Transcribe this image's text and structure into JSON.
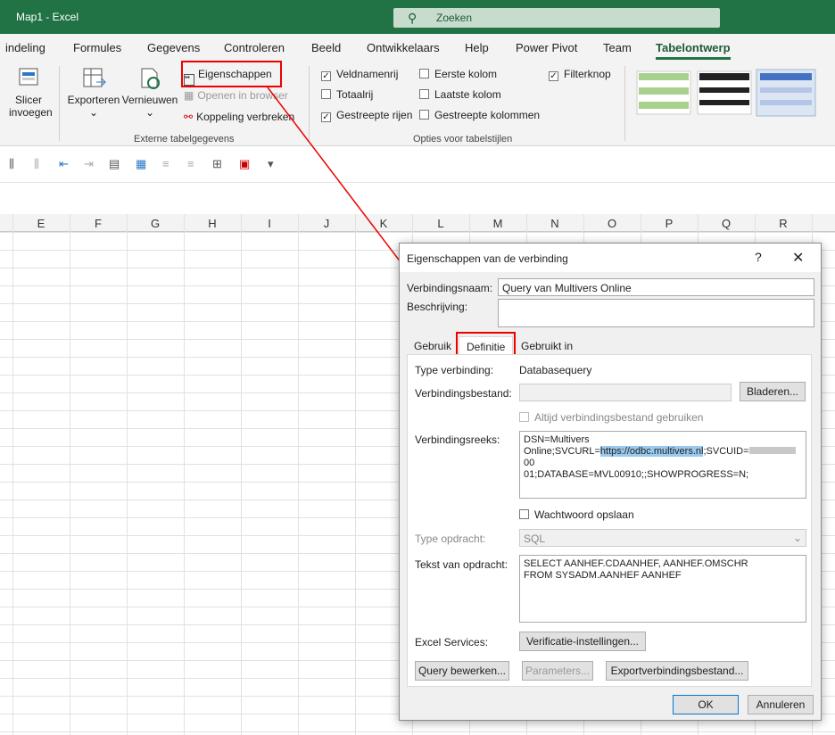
{
  "titlebar": {
    "title": "Map1  -  Excel",
    "search": "Zoeken",
    "search_icon": "search-icon"
  },
  "tabs": [
    "indeling",
    "Formules",
    "Gegevens",
    "Controleren",
    "Beeld",
    "Ontwikkelaars",
    "Help",
    "Power Pivot",
    "Team",
    "Tabelontwerp"
  ],
  "ribbon": {
    "slicer_1": "Slicer",
    "slicer_2": "invoegen",
    "exporteren": "Exporteren",
    "vernieuwen": "Vernieuwen",
    "eigenschappen": "Eigenschappen",
    "openen_browser": "Openen in browser",
    "koppeling": "Koppeling verbreken",
    "group_ext": "Externe tabelgegevens",
    "opt_veldnamenrij": "Veldnamenrij",
    "opt_totaalrij": "Totaalrij",
    "opt_gestreepte_rijen": "Gestreepte rijen",
    "opt_eerste_kolom": "Eerste kolom",
    "opt_laatste_kolom": "Laatste kolom",
    "opt_gestreepte_kolommen": "Gestreepte kolommen",
    "opt_filterknop": "Filterknop",
    "group_opties": "Opties voor tabelstijlen"
  },
  "columns": [
    "E",
    "F",
    "G",
    "H",
    "I",
    "J",
    "K",
    "L",
    "M",
    "N",
    "O",
    "P",
    "Q",
    "R"
  ],
  "dialog": {
    "title": "Eigenschappen van de verbinding",
    "help": "?",
    "close": "✕",
    "name_label": "Verbindingsnaam:",
    "name_value": "Query van Multivers Online",
    "desc_label": "Beschrijving:",
    "tabs": [
      "Gebruik",
      "Definitie",
      "Gebruikt in"
    ],
    "type_label": "Type verbinding:",
    "type_value": "Databasequery",
    "file_label": "Verbindingsbestand:",
    "browse": "Bladeren...",
    "always_file": "Altijd verbindingsbestand gebruiken",
    "connstr_label": "Verbindingsreeks:",
    "connstr_1": "DSN=Multivers",
    "connstr_2a": "Online;SVCURL=",
    "connstr_2b": "https://odbc.multivers.nl",
    "connstr_2c": ";SVCUID=",
    "connstr_2d": "00",
    "connstr_3": "01;DATABASE=MVL00910;;SHOWPROGRESS=N;",
    "save_pw": "Wachtwoord opslaan",
    "cmdtype_label": "Type opdracht:",
    "cmdtype_value": "SQL",
    "cmdtext_label": "Tekst van opdracht:",
    "cmdtext_1": "SELECT AANHEF.CDAANHEF, AANHEF.OMSCHR",
    "cmdtext_2": "FROM SYSADM.AANHEF AANHEF",
    "excel_services": "Excel Services:",
    "verify": "Verificatie-instellingen...",
    "query_edit": "Query bewerken...",
    "parameters": "Parameters...",
    "export": "Exportverbindingsbestand...",
    "ok": "OK",
    "cancel": "Annuleren"
  },
  "colors": {
    "excel_green": "#217346",
    "highlight": "#e00000"
  }
}
